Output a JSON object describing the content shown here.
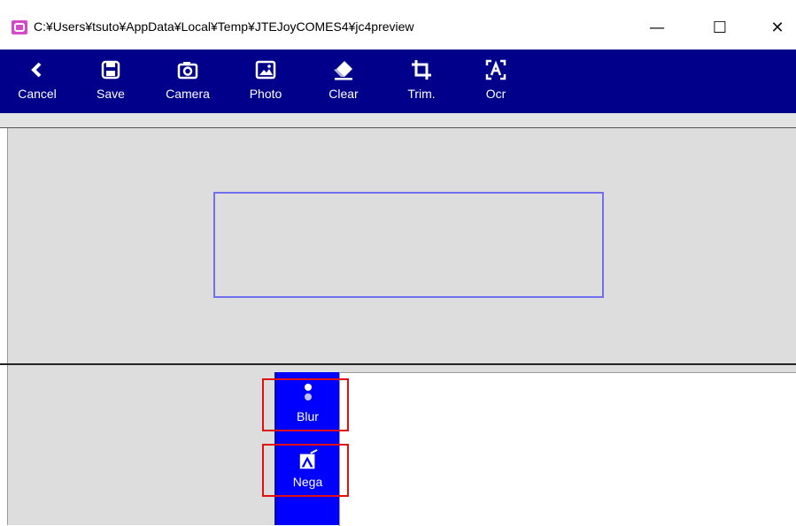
{
  "window": {
    "title": "C:¥Users¥tsuto¥AppData¥Local¥Temp¥JTEJoyCOMES4¥jc4preview",
    "minimize": "—",
    "maximize": "☐",
    "close": "✕",
    "icon": "app-icon"
  },
  "toolbar": {
    "background": "#00008b",
    "items": [
      {
        "label": "Cancel",
        "icon": "back-chevron-icon"
      },
      {
        "label": "Save",
        "icon": "floppy-disk-icon"
      },
      {
        "label": "Camera",
        "icon": "camera-icon"
      },
      {
        "label": "Photo",
        "icon": "image-icon"
      },
      {
        "label": "Clear",
        "icon": "eraser-icon"
      },
      {
        "label": "Trim.",
        "icon": "crop-icon"
      },
      {
        "label": "Ocr",
        "icon": "text-recognition-icon"
      }
    ]
  },
  "filters": {
    "background": "#0000ff",
    "items": [
      {
        "label": "Blur",
        "icon": "blur-dots-icon"
      },
      {
        "label": "Nega",
        "icon": "negative-icon"
      }
    ],
    "highlight_color": "#e01010"
  },
  "preview": {
    "frame_color": "#7070ee"
  }
}
